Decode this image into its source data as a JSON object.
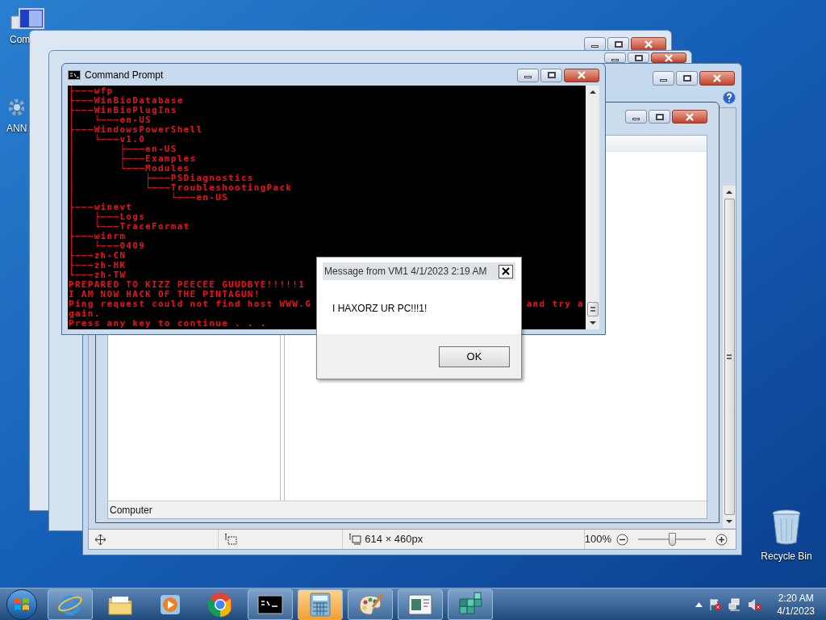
{
  "desktop_icons": [
    {
      "kind": "computer",
      "label": "Com"
    },
    {
      "kind": "settings",
      "label": "ANN"
    },
    {
      "kind": "recycle-bin",
      "label": "Recycle Bin"
    }
  ],
  "paint": {
    "size_text": "614 × 460px",
    "zoom_text": "100%",
    "zoom": {
      "level": 0.5
    }
  },
  "explorer": {
    "status": "Computer"
  },
  "console": {
    "title": "Command Prompt",
    "lines": [
      {
        "text": "├───wfp"
      },
      {
        "text": "├───WinBioDatabase"
      },
      {
        "text": "├───WinBioPlugIns"
      },
      {
        "text": "│   └───en-US"
      },
      {
        "text": "├───WindowsPowerShell"
      },
      {
        "text": "│   └───v1.0"
      },
      {
        "text": "│       ├───en-US"
      },
      {
        "text": "│       ├───Examples"
      },
      {
        "text": "│       └───Modules"
      },
      {
        "text": "│           ├───PSDiagnostics"
      },
      {
        "text": "│           └───TroubleshootingPack"
      },
      {
        "text": "│               └───en-US"
      },
      {
        "text": "├───winevt"
      },
      {
        "text": "│   ├───Logs"
      },
      {
        "text": "│   └───TraceFormat"
      },
      {
        "text": "├───winrm"
      },
      {
        "text": "│   └───0409"
      },
      {
        "text": "├───zh-CN"
      },
      {
        "text": "├───zh-HK"
      },
      {
        "text": "└───zh-TW"
      },
      {
        "text": "PREPARED TO KIZZ PEECEE GUUDBYE!!!!!1"
      },
      {
        "text": "I AM NOW HACK OF THE PINTAGUN!"
      },
      {
        "text": "Ping request could not find host WWW.G",
        "tail": "and try a"
      },
      {
        "text": "gain."
      },
      {
        "text": "Press any key to continue . . ."
      }
    ]
  },
  "message_box": {
    "title": "Message from VM1 4/1/2023 2:19 AM",
    "text": "I HAXORZ UR PC!!!1!",
    "button": "OK"
  },
  "taskbar": {
    "apps": [
      {
        "kind": "browser-e",
        "running": true,
        "flashing": false
      },
      {
        "kind": "folder",
        "running": false,
        "flashing": false
      },
      {
        "kind": "media",
        "running": false,
        "flashing": false
      },
      {
        "kind": "chrome",
        "running": false,
        "flashing": false
      },
      {
        "kind": "console",
        "running": true,
        "flashing": false
      },
      {
        "kind": "calculator",
        "running": true,
        "flashing": true
      },
      {
        "kind": "paint",
        "running": true,
        "flashing": false
      },
      {
        "kind": "window",
        "running": true,
        "flashing": false
      },
      {
        "kind": "cubes",
        "running": true,
        "flashing": false
      }
    ],
    "time": "2:20 AM",
    "date": "4/1/2023"
  }
}
